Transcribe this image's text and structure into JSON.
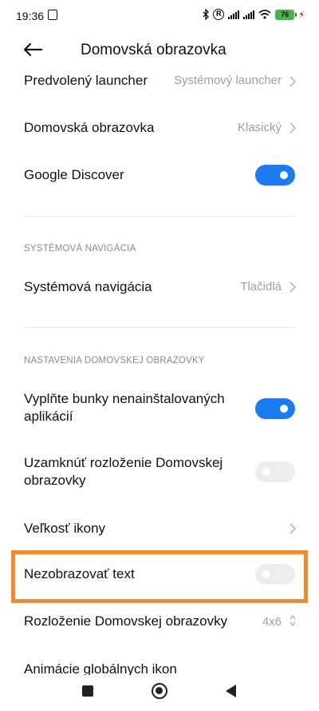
{
  "status_bar": {
    "time": "19:36",
    "battery": "76"
  },
  "header": {
    "title": "Domovská obrazovka"
  },
  "rows": {
    "launcher": {
      "label": "Predvolený launcher",
      "value": "Systémový launcher"
    },
    "home_screen": {
      "label": "Domovská obrazovka",
      "value": "Klasický"
    },
    "discover": {
      "label": "Google Discover",
      "toggle": "on"
    }
  },
  "sections": {
    "system_nav": "SYSTÉMOVÁ NAVIGÁCIA",
    "home_settings": "NASTAVENIA DOMOVSKEJ OBRAZOVKY"
  },
  "nav_row": {
    "label": "Systémová navigácia",
    "value": "Tlačidlá"
  },
  "home_rows": {
    "fill_cells": {
      "label_line1": "Vyplňte bunky nenainštalovaných",
      "label_line2": "aplikácií",
      "toggle": "on"
    },
    "lock_layout": {
      "label_line1": "Uzamknúť rozloženie Domovskej",
      "label_line2": "obrazovky",
      "toggle": "off"
    },
    "icon_size": {
      "label": "Veľkosť ikony"
    },
    "hide_text": {
      "label": "Nezobrazovať text",
      "toggle": "off"
    },
    "layout": {
      "label": "Rozloženie Domovskej obrazovky",
      "value": "4x6"
    },
    "global_anim": {
      "label": "Animácie globálnych ikon"
    }
  },
  "colors": {
    "accent": "#1a7cf0",
    "highlight": "#f28a2e",
    "battery": "#4caf50"
  }
}
